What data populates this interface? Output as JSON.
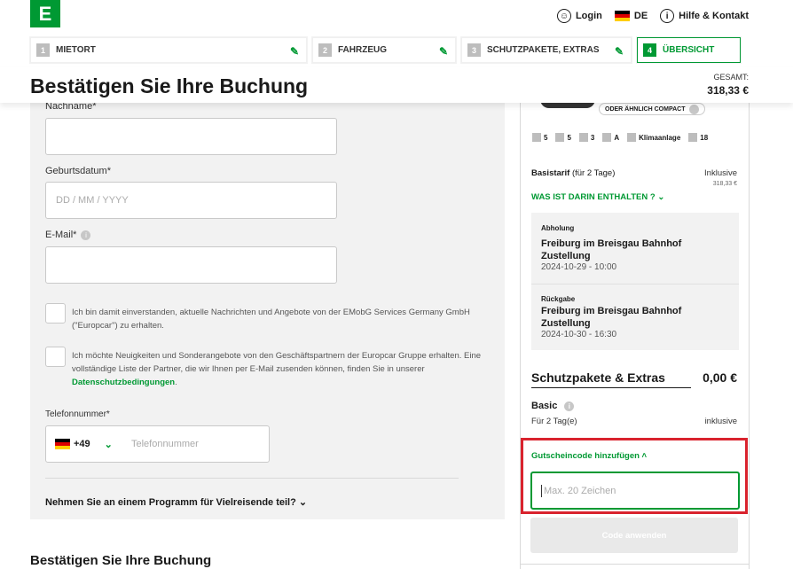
{
  "header": {
    "logo": "E",
    "login": "Login",
    "language": "DE",
    "help": "Hilfe & Kontakt"
  },
  "steps": [
    {
      "num": "1",
      "label": "MIETORT"
    },
    {
      "num": "2",
      "label": "FAHRZEUG"
    },
    {
      "num": "3",
      "label": "SCHUTZPAKETE, EXTRAS"
    },
    {
      "num": "4",
      "label": "ÜBERSICHT"
    }
  ],
  "title": "Bestätigen Sie Ihre Buchung",
  "total": {
    "label": "GESAMT:",
    "value": "318,33 €"
  },
  "form": {
    "lastname_label": "Nachname*",
    "dob_label": "Geburtsdatum*",
    "dob_placeholder": "DD / MM / YYYY",
    "email_label": "E-Mail*",
    "consent1": "Ich bin damit einverstanden, aktuelle Nachrichten und Angebote von der EMobG Services Germany GmbH (\"Europcar\") zu erhalten.",
    "consent2_text": "Ich möchte Neuigkeiten und Sonderangebote von den Geschäftspartnern der Europcar Gruppe erhalten. Eine vollständige Liste der Partner, die wir Ihnen per E-Mail zusenden können, finden Sie in unserer",
    "consent2_link": "Datenschutzbedingungen",
    "phone_label": "Telefonnummer*",
    "phone_code": "+49",
    "phone_placeholder": "Telefonnummer",
    "frequent_flyer": "Nehmen Sie an einem Programm für Vielreisende teil?"
  },
  "bottom_title": "Bestätigen Sie Ihre Buchung",
  "summary": {
    "car_tag": "ODER ÄHNLICH COMPACT",
    "features": [
      {
        "icon": "seat-icon",
        "value": "5"
      },
      {
        "icon": "door-icon",
        "value": "5"
      },
      {
        "icon": "luggage-icon",
        "value": "3"
      },
      {
        "icon": "gearbox-icon",
        "value": "A"
      },
      {
        "icon": "aircon-icon",
        "value": "Klimaanlage"
      },
      {
        "icon": "age-icon",
        "value": "18"
      }
    ],
    "basis_label": "Basistarif",
    "basis_days": "(für 2 Tage)",
    "basis_incl": "Inklusive",
    "basis_price": "318,33 €",
    "whats_included": "WAS IST DARIN ENTHALTEN ?",
    "pickup_label": "Abholung",
    "pickup_city": "Freiburg im Breisgau Bahnhof",
    "pickup_mode": "Zustellung",
    "pickup_date": "2024-10-29 - 10:00",
    "return_label": "Rückgabe",
    "return_city": "Freiburg im Breisgau Bahnhof",
    "return_mode": "Zustellung",
    "return_date": "2024-10-30 - 16:30",
    "extras_title": "Schutzpakete & Extras",
    "extras_value": "0,00 €",
    "basic_label": "Basic",
    "basic_days": "Für 2 Tag(e)",
    "basic_incl": "inklusive",
    "voucher_title": "Gutscheincode hinzufügen",
    "voucher_placeholder": "Max. 20 Zeichen",
    "apply_button": "Code anwenden"
  },
  "colors": {
    "brand": "#009933",
    "highlight": "#d9232e"
  }
}
